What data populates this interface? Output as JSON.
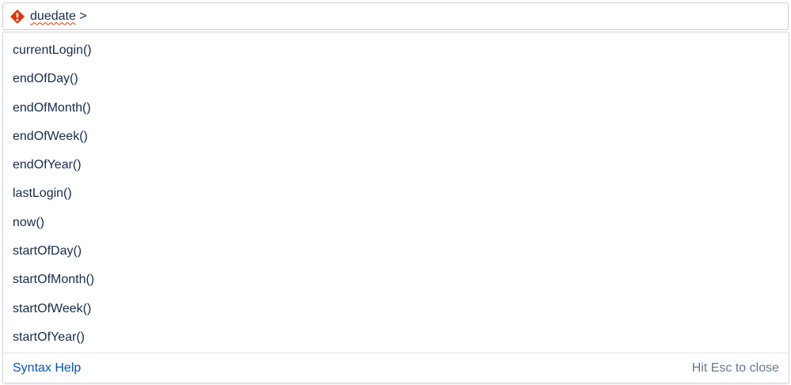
{
  "query": {
    "field": "duedate",
    "operator": ">",
    "status_icon": "error-icon",
    "error_color": "#de350b"
  },
  "suggestions": [
    "currentLogin()",
    "endOfDay()",
    "endOfMonth()",
    "endOfWeek()",
    "endOfYear()",
    "lastLogin()",
    "now()",
    "startOfDay()",
    "startOfMonth()",
    "startOfWeek()",
    "startOfYear()"
  ],
  "footer": {
    "help_link": "Syntax Help",
    "hint": "Hit Esc to close"
  },
  "colors": {
    "text": "#172b4d",
    "link": "#0052cc",
    "muted": "#6b778c"
  }
}
